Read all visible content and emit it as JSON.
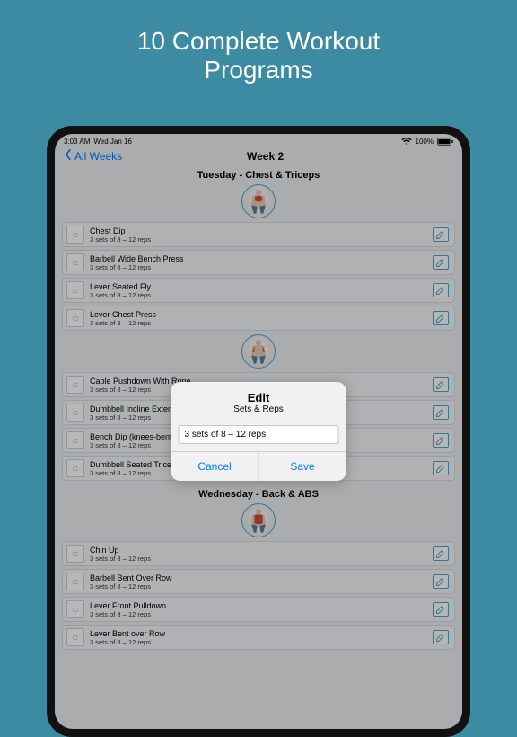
{
  "promo": {
    "line1": "10 Complete Workout",
    "line2": "Programs"
  },
  "status": {
    "time": "3:03 AM",
    "date": "Wed Jan 16",
    "battery": "100%"
  },
  "nav": {
    "back_label": "All Weeks",
    "title": "Week 2"
  },
  "sections": [
    {
      "title": "Tuesday - Chest & Triceps",
      "groups": [
        [
          {
            "name": "Chest Dip",
            "sets": "3 sets of 8 – 12 reps"
          },
          {
            "name": "Barbell Wide Bench Press",
            "sets": "3 sets of 8 – 12 reps"
          },
          {
            "name": "Lever Seated Fly",
            "sets": "3 sets of 8 – 12 reps"
          },
          {
            "name": "Lever Chest Press",
            "sets": "3 sets of 8 – 12 reps"
          }
        ],
        [
          {
            "name": "Cable Pushdown With Rope",
            "sets": "3 sets of 8 – 12 reps"
          },
          {
            "name": "Dumbbell Incline Extension",
            "sets": "3 sets of 8 – 12 reps"
          },
          {
            "name": "Bench Dip (knees-bent)",
            "sets": "3 sets of 8 – 12 reps"
          },
          {
            "name": "Dumbbell Seated Triceps Press",
            "sets": "3 sets of 8 – 12 reps"
          }
        ]
      ]
    },
    {
      "title": "Wednesday - Back & ABS",
      "groups": [
        [
          {
            "name": "Chin Up",
            "sets": "3 sets of 8 – 12 reps"
          },
          {
            "name": "Barbell Bent Over Row",
            "sets": "3 sets of 8 – 12 reps"
          },
          {
            "name": "Lever Front Pulldown",
            "sets": "3 sets of 8 – 12 reps"
          },
          {
            "name": "Lever Bent over Row",
            "sets": "3 sets of 8 – 12 reps"
          }
        ]
      ]
    }
  ],
  "modal": {
    "title": "Edit",
    "subtitle": "Sets & Reps",
    "value": "3 sets of 8 – 12 reps",
    "cancel": "Cancel",
    "save": "Save"
  },
  "icons": {
    "wifi": "wifi-icon",
    "battery": "battery-icon",
    "chevron": "chevron-left-icon",
    "pencil": "pencil-icon"
  },
  "colors": {
    "bg": "#3d8ba3",
    "accent": "#4aa6c6",
    "ios_blue": "#007aff"
  }
}
